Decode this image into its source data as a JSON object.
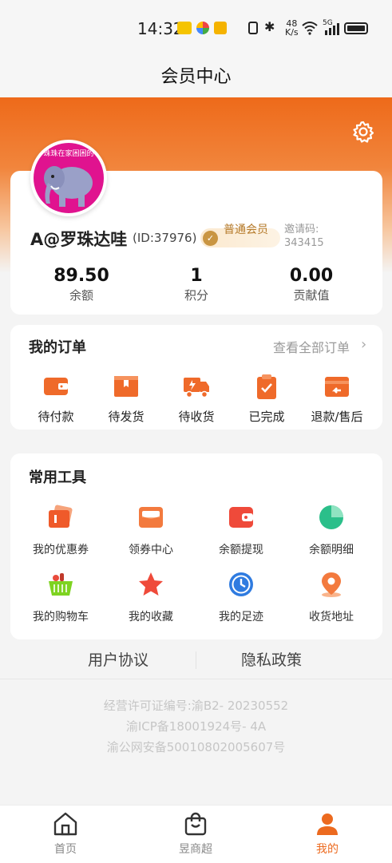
{
  "status": {
    "time": "14:32",
    "net_speed_top": "48",
    "net_speed_bottom": "K/s",
    "signal_label": "5G"
  },
  "nav": {
    "title": "会员中心"
  },
  "profile": {
    "avatar_text": "珠珠在家困困的",
    "username": "A@罗珠达哇",
    "user_id": "(ID:37976)",
    "member_level": "普通会员",
    "invite_label": "邀请码:",
    "invite_code": "343415",
    "stats": [
      {
        "value": "89.50",
        "label": "余额"
      },
      {
        "value": "1",
        "label": "积分"
      },
      {
        "value": "0.00",
        "label": "贡献值"
      }
    ]
  },
  "orders": {
    "title": "我的订单",
    "view_all": "查看全部订单",
    "items": [
      {
        "label": "待付款",
        "icon": "wallet-icon"
      },
      {
        "label": "待发货",
        "icon": "package-icon"
      },
      {
        "label": "待收货",
        "icon": "truck-icon"
      },
      {
        "label": "已完成",
        "icon": "clipboard-check-icon"
      },
      {
        "label": "退款/售后",
        "icon": "refund-icon"
      }
    ]
  },
  "tools": {
    "title": "常用工具",
    "items": [
      {
        "label": "我的优惠券",
        "icon": "coupon-icon"
      },
      {
        "label": "领券中心",
        "icon": "coupon-center-icon"
      },
      {
        "label": "余额提现",
        "icon": "wallet-withdraw-icon"
      },
      {
        "label": "余额明细",
        "icon": "pie-chart-icon"
      },
      {
        "label": "我的购物车",
        "icon": "basket-icon"
      },
      {
        "label": "我的收藏",
        "icon": "star-icon"
      },
      {
        "label": "我的足迹",
        "icon": "clock-icon"
      },
      {
        "label": "收货地址",
        "icon": "location-icon"
      }
    ]
  },
  "footer": {
    "links": [
      "用户协议",
      "隐私政策"
    ],
    "license_lines": [
      "经营许可证编号:渝B2- 20230552",
      "渝ICP备18001924号- 4A",
      "渝公网安备50010802005607号"
    ]
  },
  "tabbar": {
    "items": [
      {
        "label": "首页",
        "icon": "home-icon",
        "active": false
      },
      {
        "label": "昱商超",
        "icon": "shopping-bag-icon",
        "active": false
      },
      {
        "label": "我的",
        "icon": "user-icon",
        "active": true
      }
    ]
  },
  "colors": {
    "accent": "#ee6a1a",
    "active_tab": "#ec6a1f",
    "gold": "#b57a2a"
  }
}
